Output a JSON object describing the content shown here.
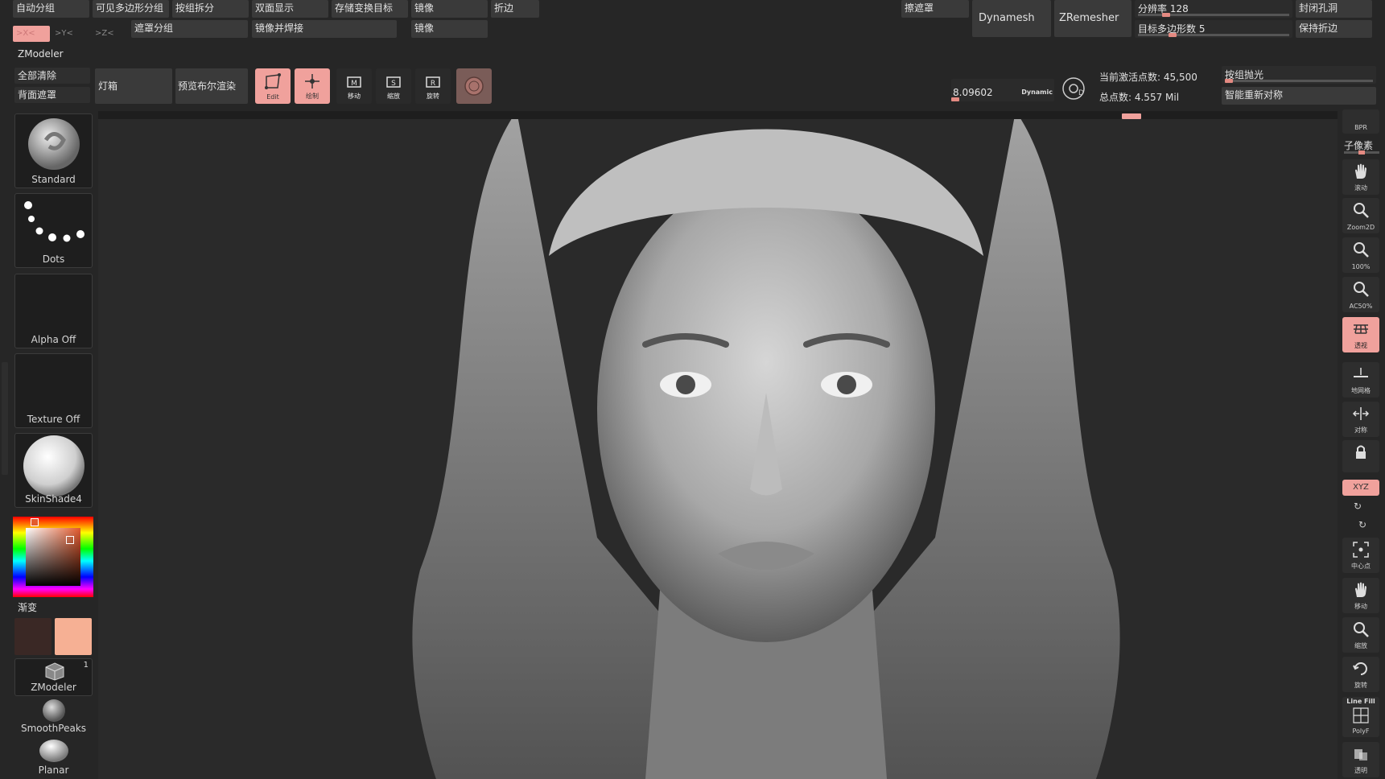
{
  "colors": {
    "accent": "#f0a19c",
    "panel": "#3a3a3a",
    "bg": "#262626"
  },
  "top_row1": {
    "auto_group": "自动分组",
    "visible_poly_group": "可见多边形分组",
    "split_by_group": "按组拆分",
    "double_sided": "双面显示",
    "store_morph_target": "存储变换目标",
    "mirror1": "镜像",
    "crease": "折边",
    "mask_partial": "擦遮罩",
    "dynamesh": "Dynamesh",
    "zremesher": "ZRemesher",
    "resolution": "分辨率 128",
    "close_holes": "封闭孔洞"
  },
  "top_row2": {
    "axis_x": ">X<",
    "axis_y": ">Y<",
    "axis_z": ">Z<",
    "mask_group": "遮罩分组",
    "mirror_weld": "镜像并焊接",
    "mirror2": "镜像",
    "target_poly": "目标多边形数 5",
    "keep_crease": "保持折边"
  },
  "palette": {
    "zmodeler": "ZModeler",
    "clear_all": "全部清除",
    "back_mask": "背面遮罩"
  },
  "toolbar": {
    "lightbox": "灯箱",
    "bpr_preview": "预览布尔渲染",
    "edit": "Edit",
    "draw": "绘制",
    "move": "移动",
    "scale": "缩放",
    "rotate": "旋转",
    "focal_value": "8.09602",
    "dynamic": "Dynamic",
    "active_points": "当前激活点数: 45,500",
    "total_points": "总点数: 4.557 Mil",
    "polish_group": "按组抛光",
    "smart_resym": "智能重新对称"
  },
  "left_tools": {
    "brush": "Standard",
    "stroke": "Dots",
    "alpha": "Alpha Off",
    "texture": "Texture Off",
    "material": "SkinShade4",
    "gradient": "渐变",
    "tool_zmodeler": "ZModeler",
    "tool_count": "1",
    "smoothpeaks": "SmoothPeaks",
    "planar": "Planar"
  },
  "right_shelf": {
    "bpr": "BPR",
    "subpixel": "子像素",
    "pan": "滚动",
    "zoom2d": "Zoom2D",
    "hundred": "100%",
    "ac50": "AC50%",
    "persp": "透视",
    "floor": "地网格",
    "sym": "对称",
    "lock": "",
    "xyz": "XYZ",
    "frame": "中心点",
    "move": "移动",
    "zoom": "缩放",
    "rotate": "旋转",
    "linefill": "Line Fill",
    "polyf": "PolyF",
    "transp": "透明"
  }
}
